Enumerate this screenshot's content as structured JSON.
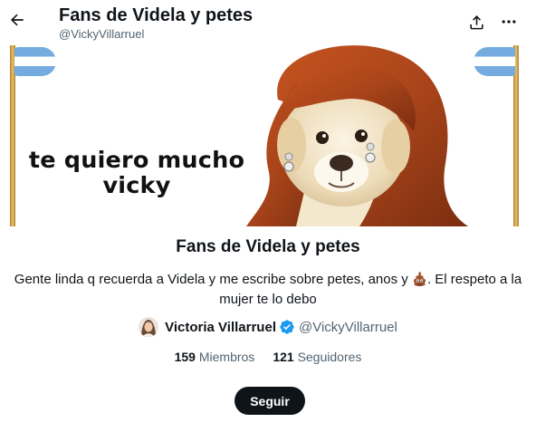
{
  "header": {
    "title": "Fans de Videla y petes",
    "handle": "@VickyVillarruel"
  },
  "banner": {
    "text_line1": "te quiero mucho",
    "text_line2": "vicky"
  },
  "group": {
    "name": "Fans de Videla y petes",
    "description_part1": "Gente linda q recuerda a Videla y me escribe sobre petes, anos y",
    "description_part2": ". El respeto a la mujer te lo debo",
    "description_emoji": "pile-of-poo-icon"
  },
  "owner": {
    "name": "Victoria Villarruel",
    "handle": "@VickyVillarruel"
  },
  "stats": {
    "members_count": "159",
    "members_label": "Miembros",
    "followers_count": "121",
    "followers_label": "Seguidores"
  },
  "actions": {
    "follow_label": "Seguir"
  },
  "colors": {
    "text_primary": "#0f1419",
    "text_secondary": "#536471",
    "verified_blue": "#1d9bf0",
    "flag_blue": "#74acdf",
    "button_dark": "#0f1419"
  }
}
